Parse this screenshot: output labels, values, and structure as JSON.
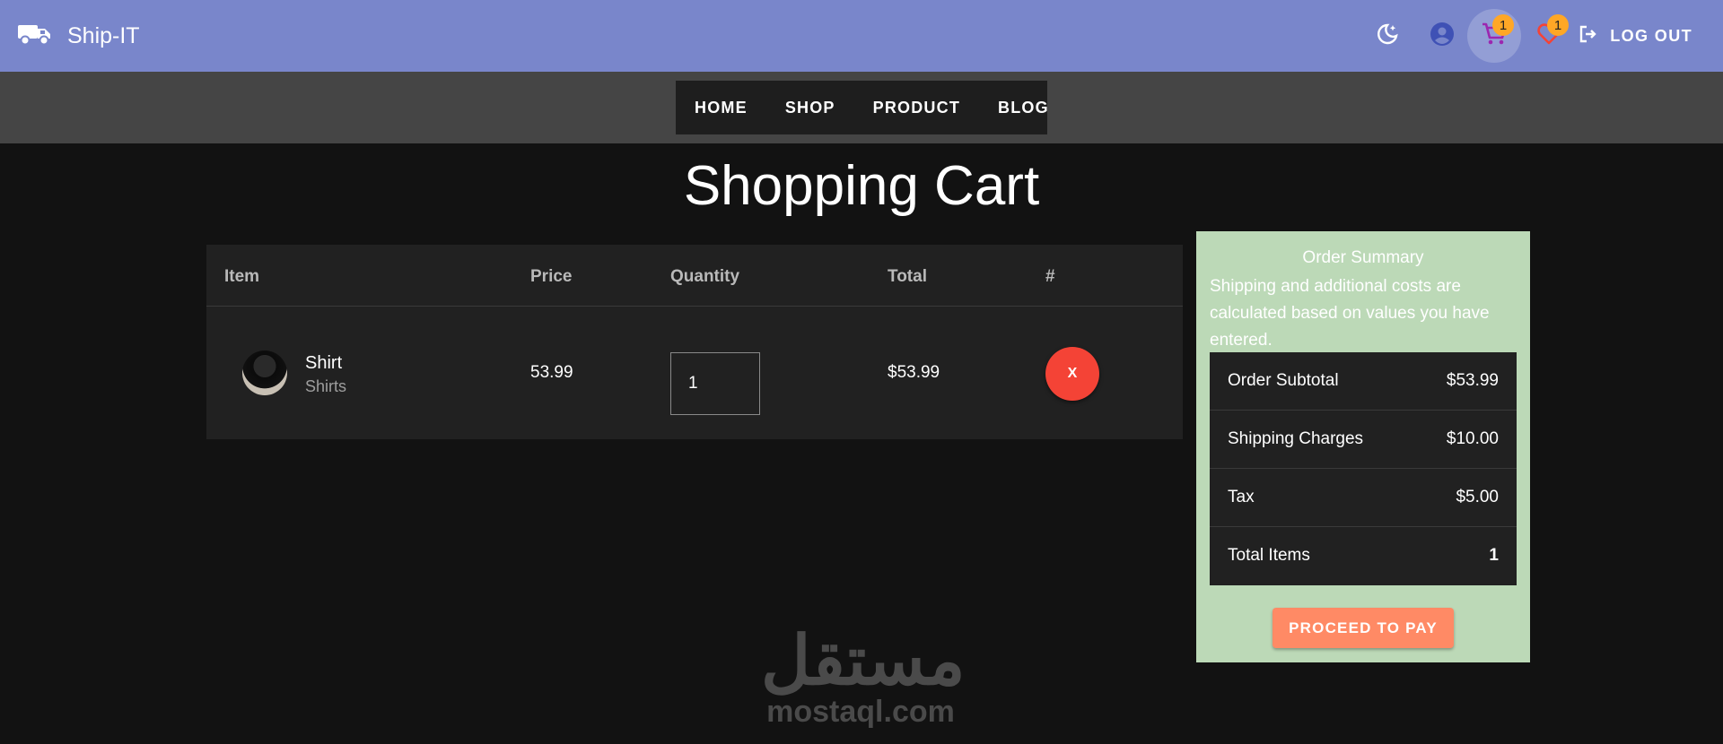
{
  "appbar": {
    "title": "Ship-IT",
    "cart_count": "1",
    "wishlist_count": "1",
    "logout_label": "LOG OUT"
  },
  "nav": {
    "items": [
      {
        "label": "HOME"
      },
      {
        "label": "SHOP"
      },
      {
        "label": "PRODUCT"
      },
      {
        "label": "BLOG"
      }
    ]
  },
  "page_title": "Shopping Cart",
  "cart": {
    "headers": {
      "item": "Item",
      "price": "Price",
      "quantity": "Quantity",
      "total": "Total",
      "remove": "#"
    },
    "rows": [
      {
        "name": "Shirt",
        "category": "Shirts",
        "price": "53.99",
        "quantity": "1",
        "total": "$53.99",
        "remove_label": "X"
      }
    ]
  },
  "summary": {
    "title": "Order Summary",
    "note": "Shipping and additional costs are calculated based on values you have entered.",
    "rows": [
      {
        "label": "Order Subtotal",
        "value": "$53.99"
      },
      {
        "label": "Shipping Charges",
        "value": "$10.00"
      },
      {
        "label": "Tax",
        "value": "$5.00"
      },
      {
        "label": "Total Items",
        "value": "1"
      }
    ],
    "pay_label": "PROCEED TO PAY"
  },
  "watermark": {
    "arabic": "مستقل",
    "latin": "mostaql.com"
  },
  "colors": {
    "appbar": "#7986cb",
    "summary_bg": "#bcd9b7",
    "remove": "#f44336",
    "pay": "#ff8a65",
    "badge": "#ffa726"
  },
  "icons": {
    "brand": "truck-icon",
    "theme": "dark-mode-icon",
    "account": "account-circle-icon",
    "cart": "cart-icon",
    "wishlist": "heart-icon",
    "logout": "logout-icon"
  }
}
